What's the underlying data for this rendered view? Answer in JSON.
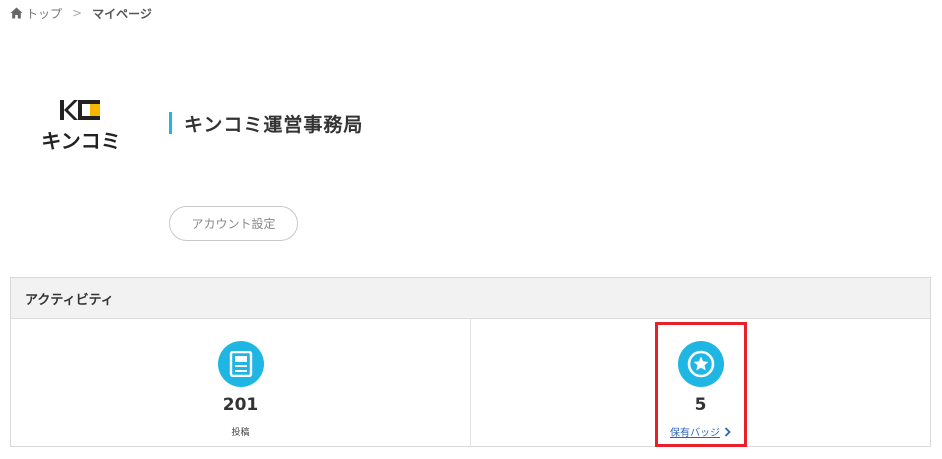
{
  "breadcrumb": {
    "home_label": "トップ",
    "separator": ">",
    "current_label": "マイページ"
  },
  "profile": {
    "logo_text": "キンコミ",
    "logo_letters": "KC",
    "name": "キンコミ運営事務局",
    "account_button_label": "アカウント設定"
  },
  "activity": {
    "title": "アクティビティ",
    "posts": {
      "value": "201",
      "label": "投稿"
    },
    "badges": {
      "value": "5",
      "link_label": "保有バッジ"
    }
  },
  "colors": {
    "accent": "#1fb6e4",
    "link": "#2c64b8",
    "highlight": "#e8202a",
    "logo_yellow": "#f5b800"
  }
}
